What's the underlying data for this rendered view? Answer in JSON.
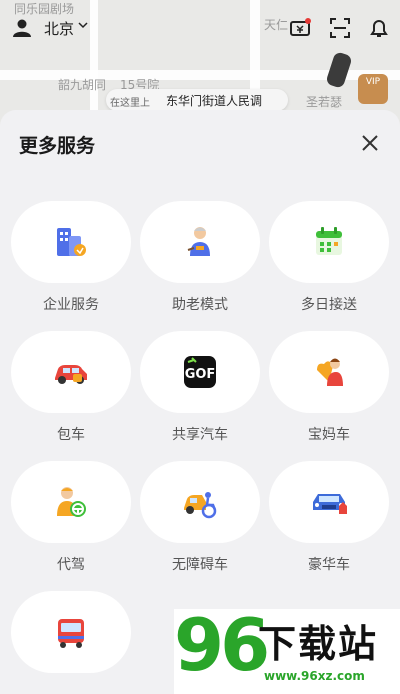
{
  "map": {
    "labels": [
      "同乐园剧场",
      "天仁",
      "韶九胡同",
      "15号院",
      "圣若瑟"
    ],
    "pin_hint": "在这里上",
    "pin_address": "东华门街道人民调",
    "vip": "VIP"
  },
  "header": {
    "city": "北京"
  },
  "sheet": {
    "title": "更多服务",
    "services": [
      {
        "label": "企业服务",
        "icon": "enterprise-building-icon"
      },
      {
        "label": "助老模式",
        "icon": "elderly-assist-icon"
      },
      {
        "label": "多日接送",
        "icon": "calendar-icon"
      },
      {
        "label": "包车",
        "icon": "car-charter-icon"
      },
      {
        "label": "共享汽车",
        "icon": "shared-car-icon"
      },
      {
        "label": "宝妈车",
        "icon": "mother-car-icon"
      },
      {
        "label": "代驾",
        "icon": "designated-driver-icon"
      },
      {
        "label": "无障碍车",
        "icon": "accessible-car-icon"
      },
      {
        "label": "豪华车",
        "icon": "luxury-car-icon"
      },
      {
        "label": "",
        "icon": "bus-icon"
      }
    ]
  },
  "watermark": {
    "brand": "96",
    "name": "下载站",
    "url": "www.96xz.com"
  }
}
